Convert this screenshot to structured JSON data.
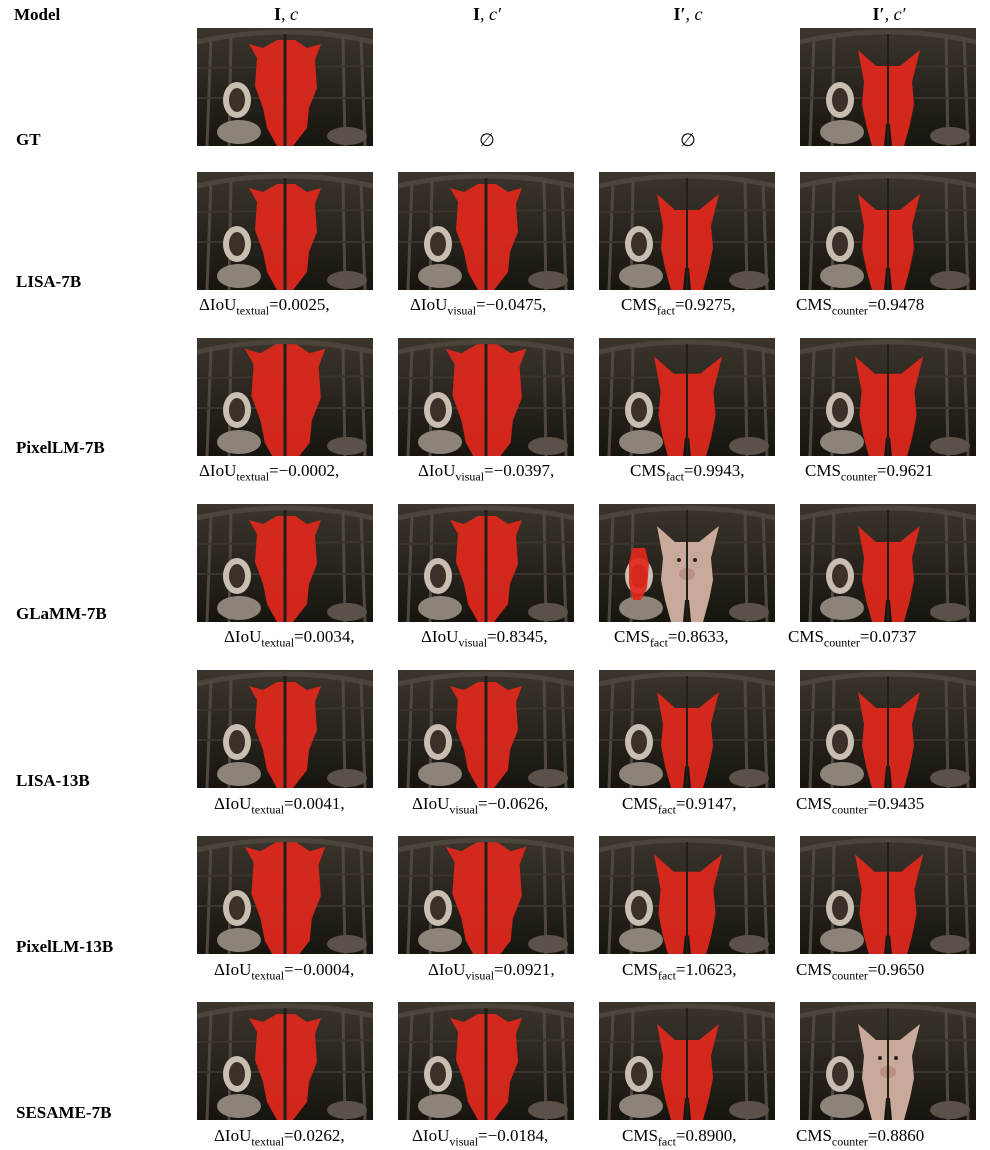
{
  "header": {
    "model": "Model",
    "col1": {
      "bold": "I",
      "rest": ", c"
    },
    "col2": {
      "bold": "I",
      "rest": ", c′"
    },
    "col3": {
      "bold": "I′",
      "rest": ", c"
    },
    "col4": {
      "bold": "I′",
      "rest": ", c′"
    }
  },
  "gt": {
    "label": "GT",
    "empty_symbol_2": "∅",
    "empty_symbol_3": "∅"
  },
  "rows": [
    {
      "label": "LISA-7B",
      "m1": {
        "name": "ΔIoU",
        "sub": "textual",
        "val": "=0.0025,"
      },
      "m2": {
        "name": "ΔIoU",
        "sub": "visual",
        "val": "=−0.0475,"
      },
      "m3": {
        "name": "CMS",
        "sub": "fact",
        "val": "=0.9275,"
      },
      "m4": {
        "name": "CMS",
        "sub": "counter",
        "val": "=0.9478"
      }
    },
    {
      "label": "PixelLM-7B",
      "m1": {
        "name": "ΔIoU",
        "sub": "textual",
        "val": "=−0.0002,"
      },
      "m2": {
        "name": "ΔIoU",
        "sub": "visual",
        "val": "=−0.0397,"
      },
      "m3": {
        "name": "CMS",
        "sub": "fact",
        "val": "=0.9943,"
      },
      "m4": {
        "name": "CMS",
        "sub": "counter",
        "val": "=0.9621"
      }
    },
    {
      "label": "GLaMM-7B",
      "m1": {
        "name": "ΔIoU",
        "sub": "textual",
        "val": "=0.0034,"
      },
      "m2": {
        "name": "ΔIoU",
        "sub": "visual",
        "val": "=0.8345,"
      },
      "m3": {
        "name": "CMS",
        "sub": "fact",
        "val": "=0.8633,"
      },
      "m4": {
        "name": "CMS",
        "sub": "counter",
        "val": "=0.0737"
      }
    },
    {
      "label": "LISA-13B",
      "m1": {
        "name": "ΔIoU",
        "sub": "textual",
        "val": "=0.0041,"
      },
      "m2": {
        "name": "ΔIoU",
        "sub": "visual",
        "val": "=−0.0626,"
      },
      "m3": {
        "name": "CMS",
        "sub": "fact",
        "val": "=0.9147,"
      },
      "m4": {
        "name": "CMS",
        "sub": "counter",
        "val": "=0.9435"
      }
    },
    {
      "label": "PixelLM-13B",
      "m1": {
        "name": "ΔIoU",
        "sub": "textual",
        "val": "=−0.0004,"
      },
      "m2": {
        "name": "ΔIoU",
        "sub": "visual",
        "val": "=0.0921,"
      },
      "m3": {
        "name": "CMS",
        "sub": "fact",
        "val": "=1.0623,"
      },
      "m4": {
        "name": "CMS",
        "sub": "counter",
        "val": "=0.9650"
      }
    },
    {
      "label": "SESAME-7B",
      "m1": {
        "name": "ΔIoU",
        "sub": "textual",
        "val": "=0.0262,"
      },
      "m2": {
        "name": "ΔIoU",
        "sub": "visual",
        "val": "=−0.0184,"
      },
      "m3": {
        "name": "CMS",
        "sub": "fact",
        "val": "=0.8900,"
      },
      "m4": {
        "name": "CMS",
        "sub": "counter",
        "val": "=0.8860"
      }
    }
  ],
  "colors": {
    "mask_red": "#e0281c",
    "scene_dark": "#2a2520",
    "pig_skin": "#c9a99a"
  }
}
